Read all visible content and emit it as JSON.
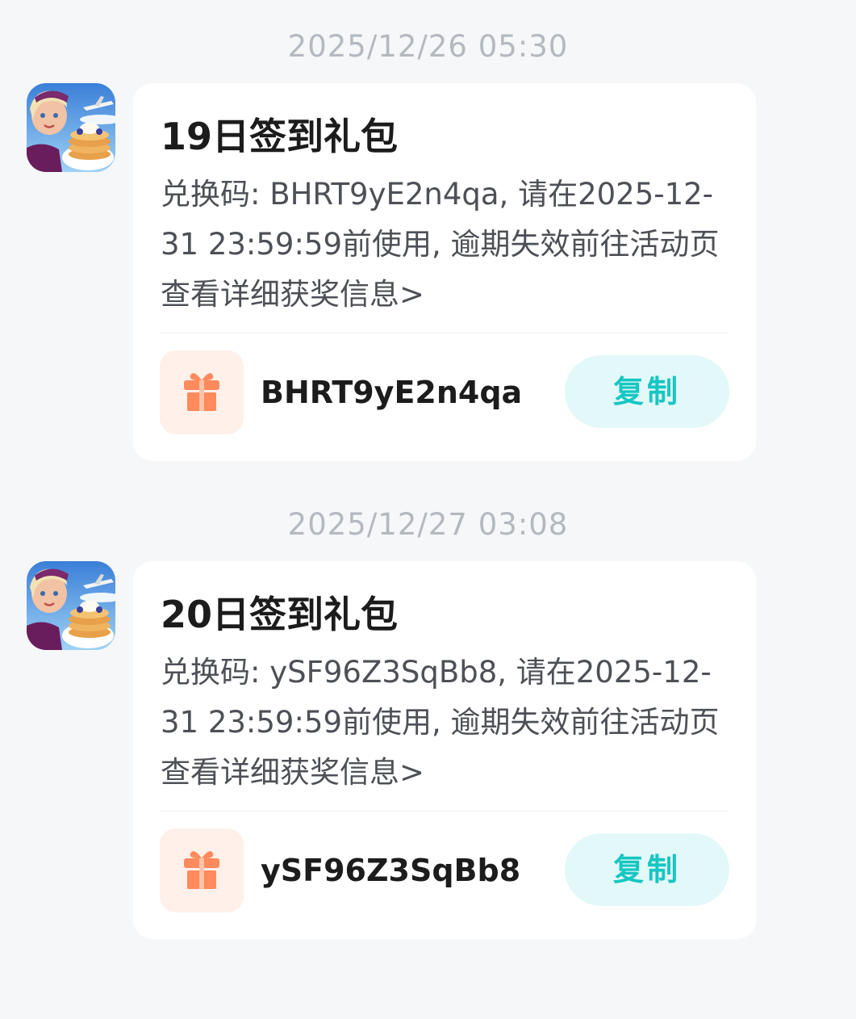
{
  "messages": [
    {
      "timestamp": "2025/12/26  05:30",
      "title": "19日签到礼包",
      "body": "兑换码: BHRT9yE2n4qa, 请在2025-12-31 23:59:59前使用, 逾期失效前往活动页查看详细获奖信息",
      "more_link": ">",
      "code": "BHRT9yE2n4qa",
      "copy_label": "复制"
    },
    {
      "timestamp": "2025/12/27  03:08",
      "title": "20日签到礼包",
      "body": "兑换码: ySF96Z3SqBb8, 请在2025-12-31 23:59:59前使用, 逾期失效前往活动页查看详细获奖信息",
      "more_link": ">",
      "code": "ySF96Z3SqBb8",
      "copy_label": "复制"
    }
  ],
  "icons": {
    "avatar": "game-avatar-icon",
    "gift": "gift-icon"
  },
  "colors": {
    "accent": "#17c6c2",
    "accent_bg": "#e3f8f8",
    "gift": "#ff8a5c",
    "gift_bg": "#fff0ea",
    "page_bg": "#f5f7f9"
  }
}
